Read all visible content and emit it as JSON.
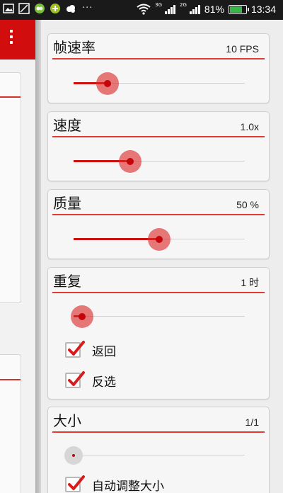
{
  "status_bar": {
    "battery_text": "81%",
    "battery_level": 0.81,
    "time": "13:34",
    "network_1": "3G",
    "network_2": "2G",
    "more": "···"
  },
  "accent_color": "#d7322b",
  "panel": {
    "frame_rate": {
      "title": "帧速率",
      "value": "10 FPS",
      "slider_fraction": 0.2
    },
    "speed": {
      "title": "速度",
      "value": "1.0x",
      "slider_fraction": 0.33
    },
    "quality": {
      "title": "质量",
      "value": "50 %",
      "slider_fraction": 0.5
    },
    "repeat": {
      "title": "重复",
      "value": "1 时",
      "slider_fraction": 0.05,
      "options": [
        {
          "label": "返回",
          "checked": true
        },
        {
          "label": "反选",
          "checked": true
        }
      ]
    },
    "size": {
      "title": "大小",
      "value": "1/1",
      "slider_fraction": 0.0,
      "options": [
        {
          "label": "自动调整大小",
          "checked": true
        }
      ]
    }
  }
}
